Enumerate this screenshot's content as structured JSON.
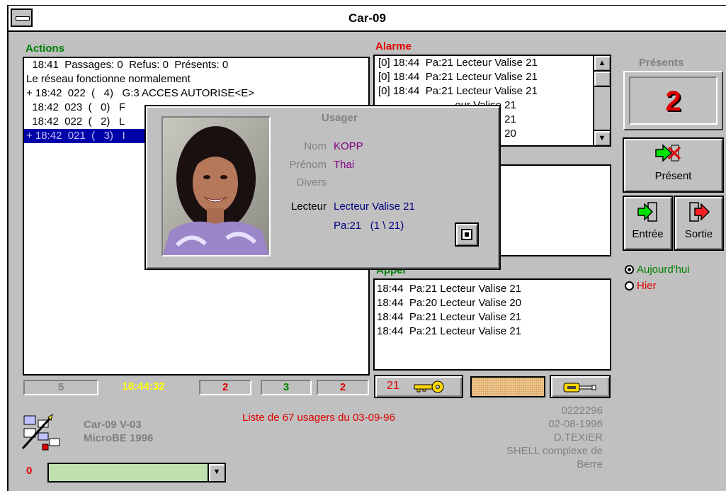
{
  "window": {
    "title": "Car-09"
  },
  "actions": {
    "label": "Actions",
    "lines": [
      "  18:41  Passages: 0  Refus: 0  Présents: 0",
      "Le réseau fonctionne normalement",
      "+ 18:42  022  (   4)   G:3 ACCES AUTORISE<E>",
      "  18:42  023  (   0)   F",
      "  18:42  022  (   2)   L",
      "+ 18:42  021  (   3)   I"
    ],
    "selected_index": 5
  },
  "alarme": {
    "label": "Alarme",
    "lines": [
      "[0] 18:44  Pa:21 Lecteur Valise 21",
      "[0] 18:44  Pa:21 Lecteur Valise 21",
      "[0] 18:44  Pa:21 Lecteur Valise 21",
      "                          eur Valise 21",
      "                          eur Valise 21",
      "                          eur Valise 20"
    ]
  },
  "appel": {
    "label": "Appel",
    "lines": [
      "18:44  Pa:21 Lecteur Valise 21",
      "18:44  Pa:20 Lecteur Valise 20",
      "18:44  Pa:21 Lecteur Valise 21",
      "18:44  Pa:21 Lecteur Valise 21"
    ]
  },
  "status_fields": {
    "f1": "5",
    "time": "18:44:32",
    "f3": "2",
    "f4": "3",
    "f5": "2"
  },
  "key_button": {
    "label": "21"
  },
  "presents": {
    "label": "Présents",
    "count": "2"
  },
  "buttons": {
    "present": "Présent",
    "entree": "Entrée",
    "sortie": "Sortie"
  },
  "radio": {
    "today": "Aujourd'hui",
    "yesterday": "Hier",
    "selected": "today"
  },
  "usager": {
    "title": "Usager",
    "nom_label": "Nom",
    "nom": "KOPP",
    "prenom_label": "Prénom",
    "prenom": "Thai",
    "divers_label": "Divers",
    "lecteur_label": "Lecteur",
    "lecteur": "Lecteur Valise 21",
    "pa": "Pa:21   (1 \\ 21)"
  },
  "footer": {
    "app_line1": "Car-09 V-03",
    "app_line2": "MicroBE 1996",
    "list_info": "Liste de 67 usagers du 03-09-96",
    "info_lines": [
      "0222296",
      "02-08-1996",
      "D.TEXIER",
      "SHELL complexe de",
      "Berre"
    ],
    "counter": "0"
  },
  "colors": {
    "green": "#008000",
    "red": "#e00000",
    "yellow": "#ffff00",
    "purple": "#800080",
    "blue": "#000080"
  }
}
